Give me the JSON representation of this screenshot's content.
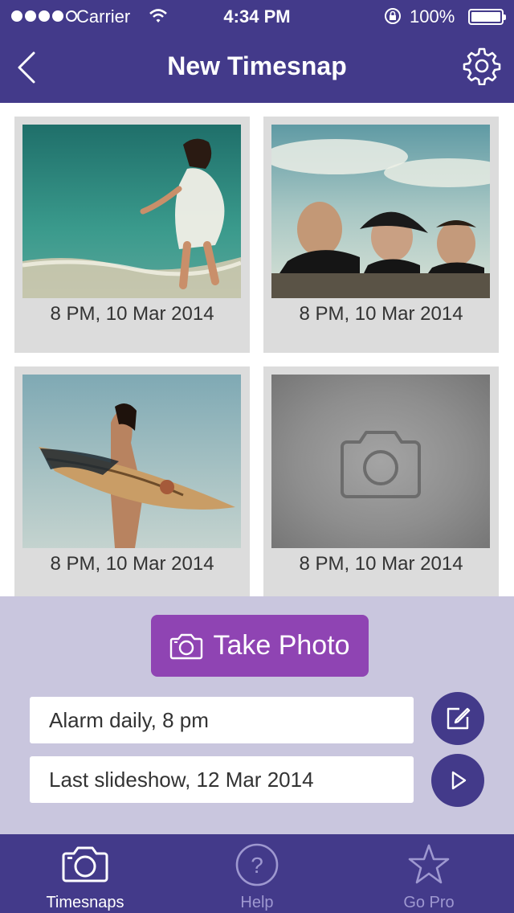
{
  "status_bar": {
    "carrier": "Carrier",
    "time": "4:34 PM",
    "battery": "100%"
  },
  "nav": {
    "title": "New Timesnap",
    "back_icon": "chevron-left-icon",
    "settings_icon": "gear-icon"
  },
  "snaps": [
    {
      "caption": "8 PM, 10 Mar 2014"
    },
    {
      "caption": "8 PM, 10 Mar 2014"
    },
    {
      "caption": "8 PM, 10 Mar 2014"
    },
    {
      "caption": "8 PM, 10 Mar 2014"
    }
  ],
  "actions": {
    "take_photo_label": "Take Photo",
    "alarm_text": "Alarm daily, 8 pm",
    "slideshow_text": "Last slideshow, 12 Mar 2014"
  },
  "tabs": [
    {
      "label": "Timesnaps",
      "icon": "camera-icon",
      "active": true
    },
    {
      "label": "Help",
      "icon": "question-icon",
      "active": false
    },
    {
      "label": "Go Pro",
      "icon": "star-icon",
      "active": false
    }
  ],
  "colors": {
    "brand": "#433a8a",
    "accent": "#8f44b3",
    "panel": "#c9c6de",
    "inactive_tab": "#9e98d0"
  }
}
